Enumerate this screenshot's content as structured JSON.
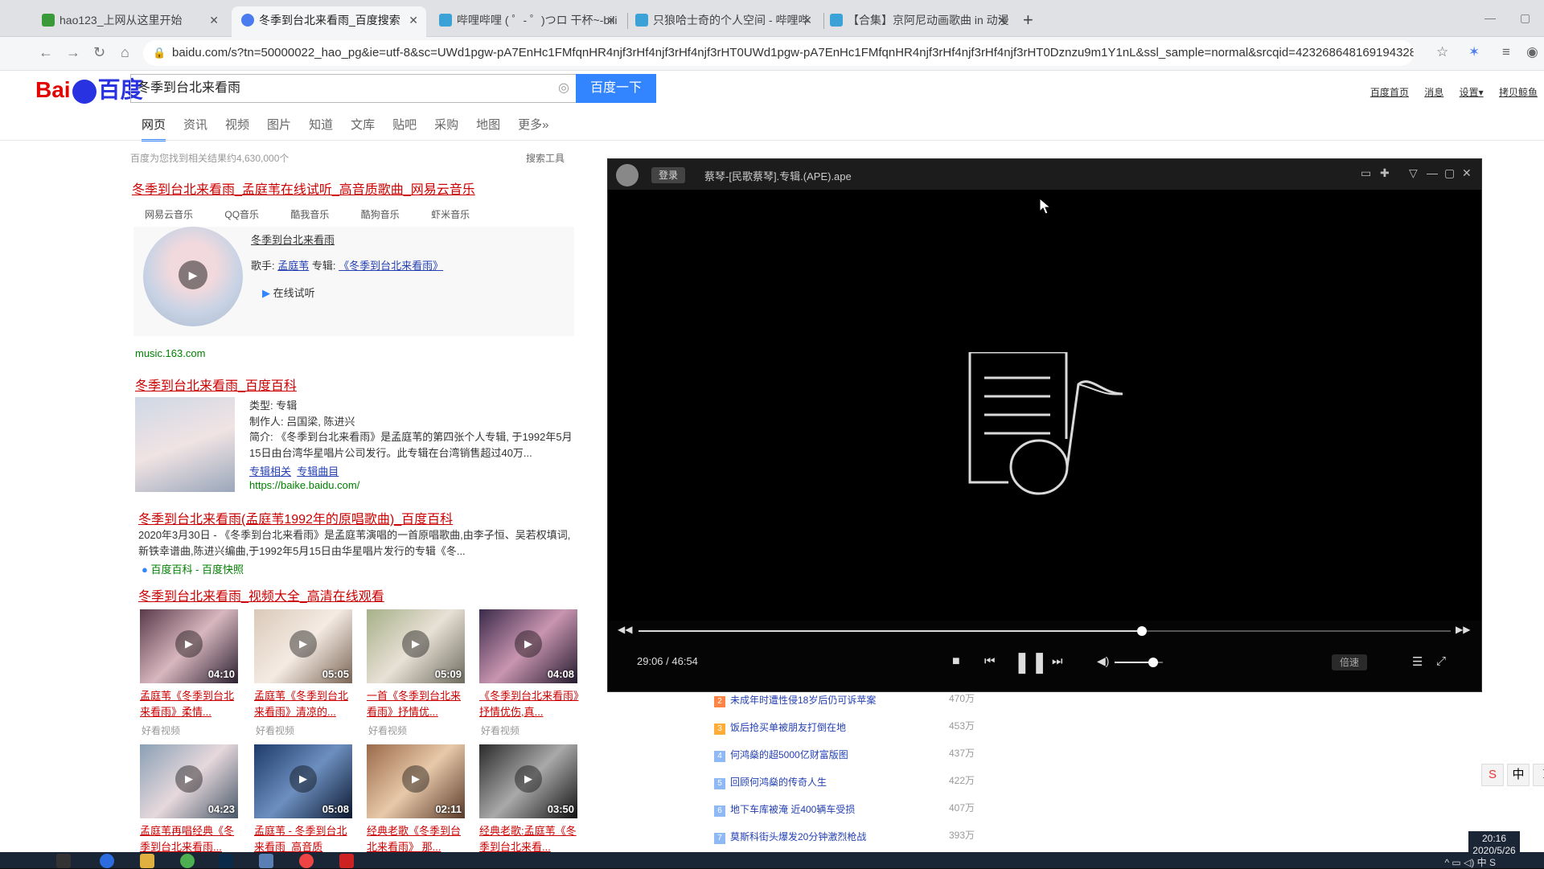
{
  "browser": {
    "tabs": [
      {
        "label": "hao123_上网从这里开始",
        "color": "#3a9a3a"
      },
      {
        "label": "冬季到台北来看雨_百度搜索",
        "color": "#4a7cf0"
      },
      {
        "label": "哔哩哔哩 ( ゜- ゜)つロ 干杯~-bili",
        "color": "#3aa2d6"
      },
      {
        "label": "只狼哈士奇的个人空间 - 哔哩哔",
        "color": "#3aa2d6"
      },
      {
        "label": "【合集】京阿尼动画歌曲 in 动漫",
        "color": "#3aa2d6"
      }
    ],
    "new_tab": "+",
    "url": "baidu.com/s?tn=50000022_hao_pg&ie=utf-8&sc=UWd1pgw-pA7EnHc1FMfqnHR4njf3rHf4njf3rHf4njf3rHT0UWd1pgw-pA7EnHc1FMfqnHR4njf3rHf4njf3rHf4njf3rHT0Dznzu9m1Y1nL&ssl_sample=normal&srcqid=4232686481691943280&f=3&rsp=0&H123Tmp=nunew7&wor...",
    "nav": {
      "back": "←",
      "forward": "→",
      "reload": "↻",
      "home": "⌂"
    }
  },
  "baidu": {
    "logo": {
      "bai": "Bai",
      "du": "du",
      "cn": "百度"
    },
    "query": "冬季到台北来看雨",
    "search_button": "百度一下",
    "top_links": [
      "百度首页",
      "消息",
      "设置▾",
      "拷贝鲸鱼"
    ],
    "tabs": [
      "网页",
      "资讯",
      "视频",
      "图片",
      "知道",
      "文库",
      "贴吧",
      "采购",
      "地图",
      "更多»"
    ],
    "result_count": "百度为您找到相关结果约4,630,000个",
    "search_tools": "搜索工具",
    "music": {
      "title": "冬季到台北来看雨_孟庭苇在线试听_高音质歌曲_网易云音乐",
      "sources": [
        "网易云音乐",
        "QQ音乐",
        "酷我音乐",
        "酷狗音乐",
        "虾米音乐"
      ],
      "song_link": "冬季到台北来看雨",
      "singer_label": "歌手:",
      "singer": "孟庭苇",
      "album_label": "专辑:",
      "album": "《冬季到台北来看雨》",
      "listen": "在线试听",
      "site": "music.163.com"
    },
    "baike": {
      "title": "冬季到台北来看雨_百度百科",
      "type": "类型: 专辑",
      "producer": "制作人: 吕国梁, 陈进兴",
      "summary": "简介: 《冬季到台北来看雨》是孟庭苇的第四张个人专辑, 于1992年5月15日由台湾华星唱片公司发行。此专辑在台湾销售超过40万...",
      "links": [
        "专辑相关",
        "专辑曲目"
      ],
      "url": "https://baike.baidu.com/"
    },
    "third": {
      "title": "冬季到台北来看雨(孟庭苇1992年的原唱歌曲)_百度百科",
      "text": "2020年3月30日 - 《冬季到台北来看雨》是孟庭苇演唱的一首原唱歌曲,由李子恒、吴若权填词,新铁幸谱曲,陈进兴编曲,于1992年5月15日由华星唱片发行的专辑《冬...",
      "src": "百度百科 - 百度快照"
    },
    "video": {
      "title": "冬季到台北来看雨_视频大全_高清在线观看",
      "items": [
        {
          "duration": "04:10",
          "caption": "孟庭苇《冬季到台北来看雨》柔情...",
          "source": "好看视频"
        },
        {
          "duration": "05:05",
          "caption": "孟庭苇《冬季到台北来看雨》清凉的...",
          "source": "好看视频"
        },
        {
          "duration": "05:09",
          "caption": "一首《冬季到台北来看雨》抒情优...",
          "source": "好看视频"
        },
        {
          "duration": "04:08",
          "caption": "《冬季到台北来看雨》抒情优伤,真...",
          "source": "好看视频"
        },
        {
          "duration": "04:23",
          "caption": "孟庭苇再唱经典《冬季到台北来看雨...",
          "source": ""
        },
        {
          "duration": "05:08",
          "caption": "孟庭苇 - 冬季到台北来看雨_高音质",
          "source": ""
        },
        {
          "duration": "02:11",
          "caption": "经典老歌《冬季到台北来看雨》 那...",
          "source": ""
        },
        {
          "duration": "03:50",
          "caption": "经典老歌:孟庭苇《冬季到台北来看...",
          "source": ""
        }
      ]
    },
    "hot": [
      {
        "rank": "2",
        "text": "未成年时遭性侵18岁后仍可诉苹案",
        "value": "470万"
      },
      {
        "rank": "3",
        "text": "饭后抢买单被朋友打倒在地",
        "value": "453万"
      },
      {
        "rank": "4",
        "text": "何鸿燊的超5000亿财富版图",
        "value": "437万"
      },
      {
        "rank": "5",
        "text": "回顾何鸿燊的传奇人生",
        "value": "422万"
      },
      {
        "rank": "6",
        "text": "地下车库被淹 近400辆车受损",
        "value": "407万"
      },
      {
        "rank": "7",
        "text": "莫斯科街头爆发20分钟激烈枪战",
        "value": "393万"
      }
    ]
  },
  "player": {
    "login": "登录",
    "filename": "蔡琴-[民歌蔡琴].专辑.(APE).ape",
    "time": "29:06 / 46:54",
    "progress": 0.62,
    "volume": 0.8,
    "speed": "倍速"
  },
  "taskbar": {
    "time": "20:16",
    "date": "2020/5/26",
    "ime": [
      "S",
      "中",
      "☽"
    ],
    "tray": "^ ▭ ◁) 中 S"
  }
}
